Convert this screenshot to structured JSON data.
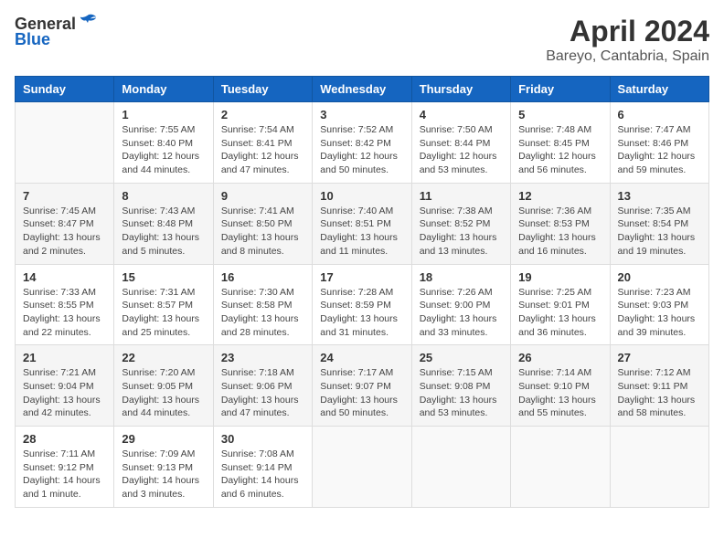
{
  "header": {
    "logo_general": "General",
    "logo_blue": "Blue",
    "month_title": "April 2024",
    "location": "Bareyo, Cantabria, Spain"
  },
  "weekdays": [
    "Sunday",
    "Monday",
    "Tuesday",
    "Wednesday",
    "Thursday",
    "Friday",
    "Saturday"
  ],
  "weeks": [
    [
      {
        "day": "",
        "info": ""
      },
      {
        "day": "1",
        "info": "Sunrise: 7:55 AM\nSunset: 8:40 PM\nDaylight: 12 hours\nand 44 minutes."
      },
      {
        "day": "2",
        "info": "Sunrise: 7:54 AM\nSunset: 8:41 PM\nDaylight: 12 hours\nand 47 minutes."
      },
      {
        "day": "3",
        "info": "Sunrise: 7:52 AM\nSunset: 8:42 PM\nDaylight: 12 hours\nand 50 minutes."
      },
      {
        "day": "4",
        "info": "Sunrise: 7:50 AM\nSunset: 8:44 PM\nDaylight: 12 hours\nand 53 minutes."
      },
      {
        "day": "5",
        "info": "Sunrise: 7:48 AM\nSunset: 8:45 PM\nDaylight: 12 hours\nand 56 minutes."
      },
      {
        "day": "6",
        "info": "Sunrise: 7:47 AM\nSunset: 8:46 PM\nDaylight: 12 hours\nand 59 minutes."
      }
    ],
    [
      {
        "day": "7",
        "info": "Sunrise: 7:45 AM\nSunset: 8:47 PM\nDaylight: 13 hours\nand 2 minutes."
      },
      {
        "day": "8",
        "info": "Sunrise: 7:43 AM\nSunset: 8:48 PM\nDaylight: 13 hours\nand 5 minutes."
      },
      {
        "day": "9",
        "info": "Sunrise: 7:41 AM\nSunset: 8:50 PM\nDaylight: 13 hours\nand 8 minutes."
      },
      {
        "day": "10",
        "info": "Sunrise: 7:40 AM\nSunset: 8:51 PM\nDaylight: 13 hours\nand 11 minutes."
      },
      {
        "day": "11",
        "info": "Sunrise: 7:38 AM\nSunset: 8:52 PM\nDaylight: 13 hours\nand 13 minutes."
      },
      {
        "day": "12",
        "info": "Sunrise: 7:36 AM\nSunset: 8:53 PM\nDaylight: 13 hours\nand 16 minutes."
      },
      {
        "day": "13",
        "info": "Sunrise: 7:35 AM\nSunset: 8:54 PM\nDaylight: 13 hours\nand 19 minutes."
      }
    ],
    [
      {
        "day": "14",
        "info": "Sunrise: 7:33 AM\nSunset: 8:55 PM\nDaylight: 13 hours\nand 22 minutes."
      },
      {
        "day": "15",
        "info": "Sunrise: 7:31 AM\nSunset: 8:57 PM\nDaylight: 13 hours\nand 25 minutes."
      },
      {
        "day": "16",
        "info": "Sunrise: 7:30 AM\nSunset: 8:58 PM\nDaylight: 13 hours\nand 28 minutes."
      },
      {
        "day": "17",
        "info": "Sunrise: 7:28 AM\nSunset: 8:59 PM\nDaylight: 13 hours\nand 31 minutes."
      },
      {
        "day": "18",
        "info": "Sunrise: 7:26 AM\nSunset: 9:00 PM\nDaylight: 13 hours\nand 33 minutes."
      },
      {
        "day": "19",
        "info": "Sunrise: 7:25 AM\nSunset: 9:01 PM\nDaylight: 13 hours\nand 36 minutes."
      },
      {
        "day": "20",
        "info": "Sunrise: 7:23 AM\nSunset: 9:03 PM\nDaylight: 13 hours\nand 39 minutes."
      }
    ],
    [
      {
        "day": "21",
        "info": "Sunrise: 7:21 AM\nSunset: 9:04 PM\nDaylight: 13 hours\nand 42 minutes."
      },
      {
        "day": "22",
        "info": "Sunrise: 7:20 AM\nSunset: 9:05 PM\nDaylight: 13 hours\nand 44 minutes."
      },
      {
        "day": "23",
        "info": "Sunrise: 7:18 AM\nSunset: 9:06 PM\nDaylight: 13 hours\nand 47 minutes."
      },
      {
        "day": "24",
        "info": "Sunrise: 7:17 AM\nSunset: 9:07 PM\nDaylight: 13 hours\nand 50 minutes."
      },
      {
        "day": "25",
        "info": "Sunrise: 7:15 AM\nSunset: 9:08 PM\nDaylight: 13 hours\nand 53 minutes."
      },
      {
        "day": "26",
        "info": "Sunrise: 7:14 AM\nSunset: 9:10 PM\nDaylight: 13 hours\nand 55 minutes."
      },
      {
        "day": "27",
        "info": "Sunrise: 7:12 AM\nSunset: 9:11 PM\nDaylight: 13 hours\nand 58 minutes."
      }
    ],
    [
      {
        "day": "28",
        "info": "Sunrise: 7:11 AM\nSunset: 9:12 PM\nDaylight: 14 hours\nand 1 minute."
      },
      {
        "day": "29",
        "info": "Sunrise: 7:09 AM\nSunset: 9:13 PM\nDaylight: 14 hours\nand 3 minutes."
      },
      {
        "day": "30",
        "info": "Sunrise: 7:08 AM\nSunset: 9:14 PM\nDaylight: 14 hours\nand 6 minutes."
      },
      {
        "day": "",
        "info": ""
      },
      {
        "day": "",
        "info": ""
      },
      {
        "day": "",
        "info": ""
      },
      {
        "day": "",
        "info": ""
      }
    ]
  ]
}
